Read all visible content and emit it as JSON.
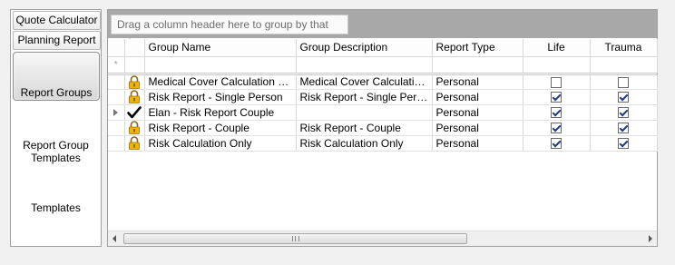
{
  "sidebar": {
    "tabs": [
      {
        "label": "Quote Calculator"
      },
      {
        "label": "Planning Report"
      }
    ],
    "items": [
      {
        "label": "Report Groups",
        "selected": true
      },
      {
        "label": "Report Group Templates"
      },
      {
        "label": "Templates"
      }
    ]
  },
  "grid": {
    "group_hint": "Drag a column header here to group by that column.",
    "columns": [
      "Group Name",
      "Group Description",
      "Report Type",
      "Life",
      "Trauma"
    ],
    "new_row_marker": "*",
    "rows": [
      {
        "icon": "lock-icon",
        "name": "Medical Cover Calculation Only",
        "description": "Medical Cover Calculation Only",
        "type": "Personal",
        "life": false,
        "trauma": false
      },
      {
        "icon": "lock-icon",
        "name": "Risk Report - Single Person",
        "description": "Risk Report - Single Person",
        "type": "Personal",
        "life": true,
        "trauma": true
      },
      {
        "icon": "checkmark-icon",
        "current": true,
        "name": "Elan - Risk Report Couple",
        "description": "",
        "type": "Personal",
        "life": true,
        "trauma": true
      },
      {
        "icon": "lock-icon",
        "name": "Risk Report - Couple",
        "description": "Risk Report - Couple",
        "type": "Personal",
        "life": true,
        "trauma": true
      },
      {
        "icon": "lock-icon",
        "name": "Risk Calculation Only",
        "description": "Risk Calculation Only",
        "type": "Personal",
        "life": true,
        "trauma": true
      }
    ],
    "scrollbar_grip": "III"
  }
}
